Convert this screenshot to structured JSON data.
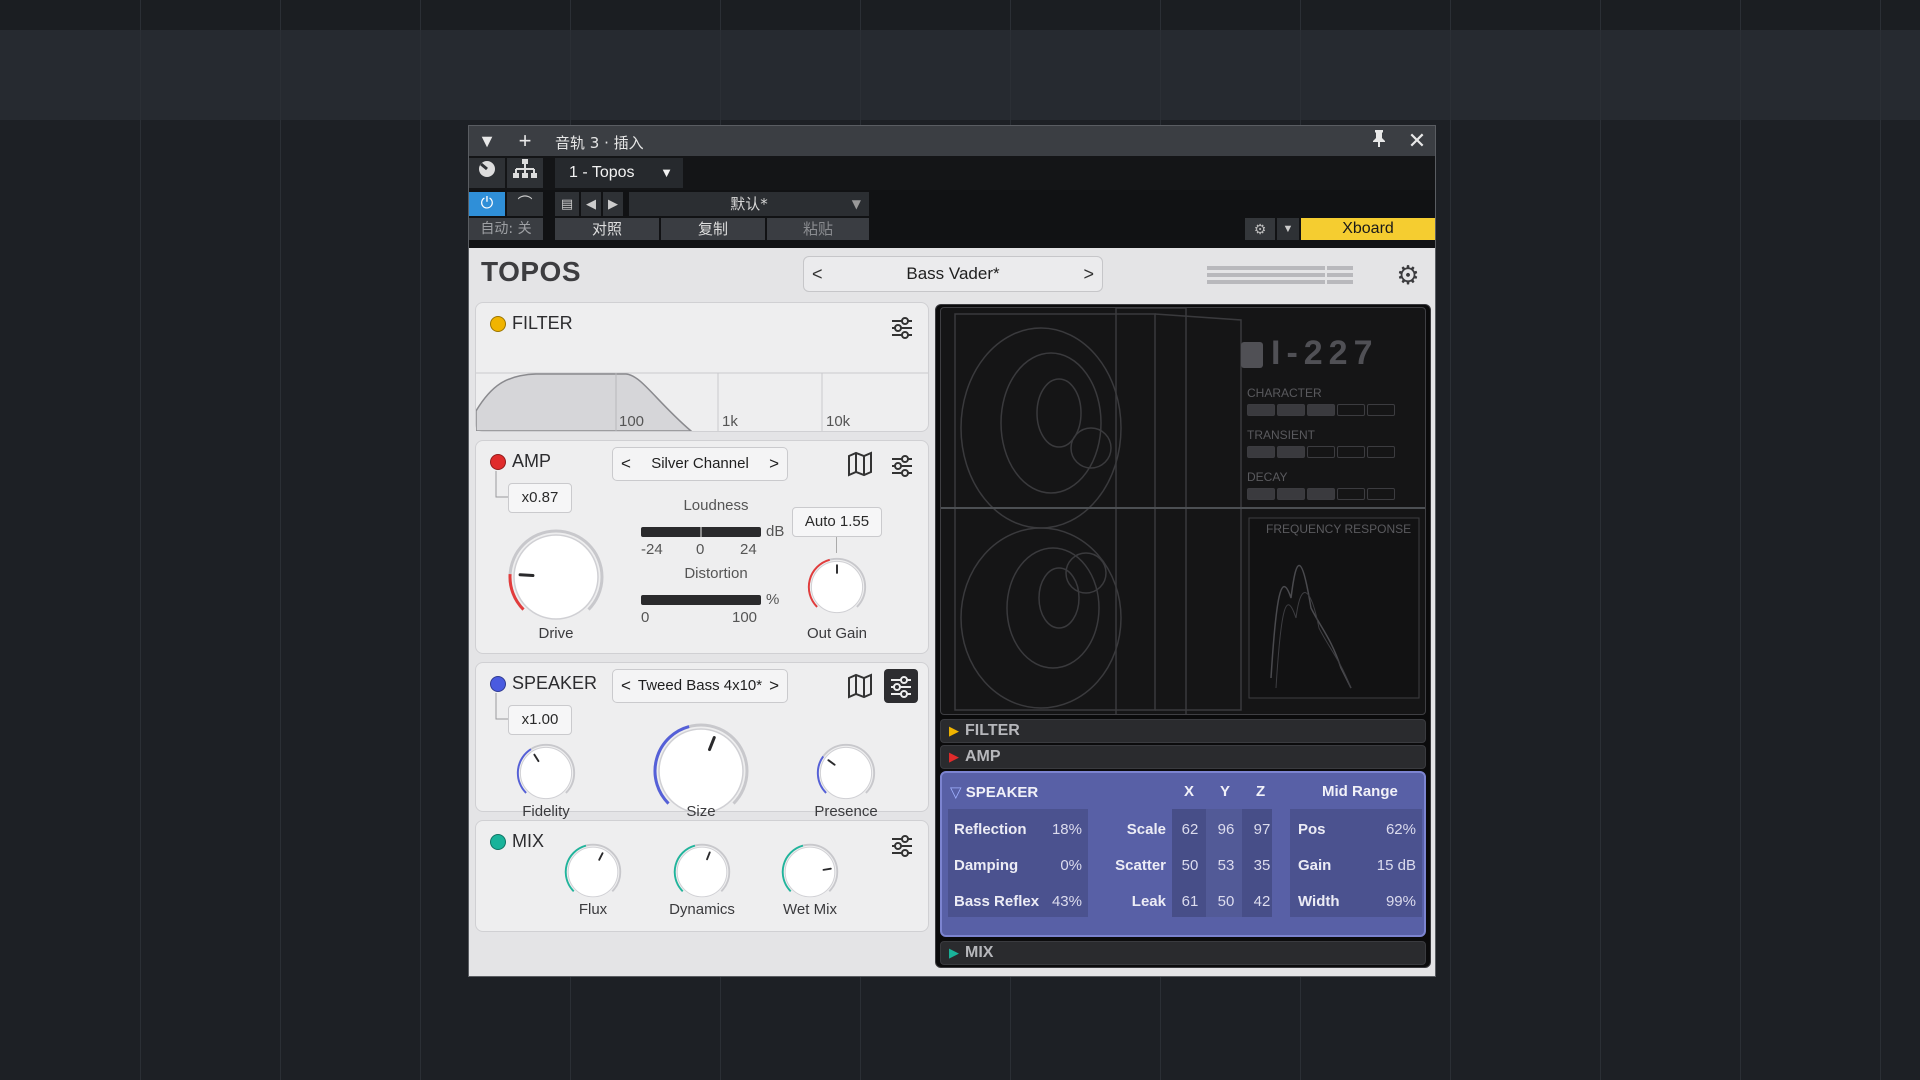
{
  "window": {
    "title": "音轨 3 · 插入",
    "plugin_slot": "1 - Topos"
  },
  "host": {
    "preset_name": "默认*",
    "auto_label": "自动: 关",
    "compare_label": "对照",
    "copy_label": "复制",
    "paste_label": "粘贴",
    "xboard_label": "Xboard",
    "accent": "#f5cd30",
    "power_color": "#2f8fd8"
  },
  "plugin": {
    "logo": "TOPOS",
    "preset": "Bass Vader*"
  },
  "filter": {
    "title": "FILTER",
    "color": "#f0b400",
    "ticks": [
      "100",
      "1k",
      "10k"
    ]
  },
  "amp": {
    "title": "AMP",
    "color": "#e02b2b",
    "model": "Silver Channel",
    "multiplier": "x0.87",
    "loudness_label": "Loudness",
    "loudness_unit": "dB",
    "loudness_ticks": [
      "-24",
      "0",
      "24"
    ],
    "distortion_label": "Distortion",
    "distortion_unit": "%",
    "distortion_ticks": [
      "0",
      "100"
    ],
    "auto_label": "Auto",
    "auto_value": "1.55",
    "drive_label": "Drive",
    "outgain_label": "Out Gain"
  },
  "speaker": {
    "title": "SPEAKER",
    "color": "#4a5be0",
    "model": "Tweed Bass 4x10*",
    "multiplier": "x1.00",
    "fidelity_label": "Fidelity",
    "size_label": "Size",
    "presence_label": "Presence"
  },
  "mix": {
    "title": "MIX",
    "color": "#19b39a",
    "flux_label": "Flux",
    "dynamics_label": "Dynamics",
    "wetmix_label": "Wet Mix"
  },
  "display": {
    "model_id": "I-227",
    "character_label": "CHARACTER",
    "transient_label": "TRANSIENT",
    "decay_label": "DECAY",
    "character_level": 3,
    "transient_level": 2,
    "decay_level": 3,
    "freq_label": "FREQUENCY RESPONSE"
  },
  "sections": {
    "filter": "FILTER",
    "amp": "AMP",
    "mix": "MIX"
  },
  "speaker_table": {
    "title": "SPEAKER",
    "col_x": "X",
    "col_y": "Y",
    "col_z": "Z",
    "mid_title": "Mid Range",
    "left": [
      {
        "k": "Reflection",
        "v": "18%"
      },
      {
        "k": "Damping",
        "v": "0%"
      },
      {
        "k": "Bass Reflex",
        "v": "43%"
      }
    ],
    "xyz": [
      {
        "k": "Scale",
        "x": "62",
        "y": "96",
        "z": "97"
      },
      {
        "k": "Scatter",
        "x": "50",
        "y": "53",
        "z": "35"
      },
      {
        "k": "Leak",
        "x": "61",
        "y": "50",
        "z": "42"
      }
    ],
    "mid": [
      {
        "k": "Pos",
        "v": "62%"
      },
      {
        "k": "Gain",
        "v": "15 dB"
      },
      {
        "k": "Width",
        "v": "99%"
      }
    ]
  }
}
